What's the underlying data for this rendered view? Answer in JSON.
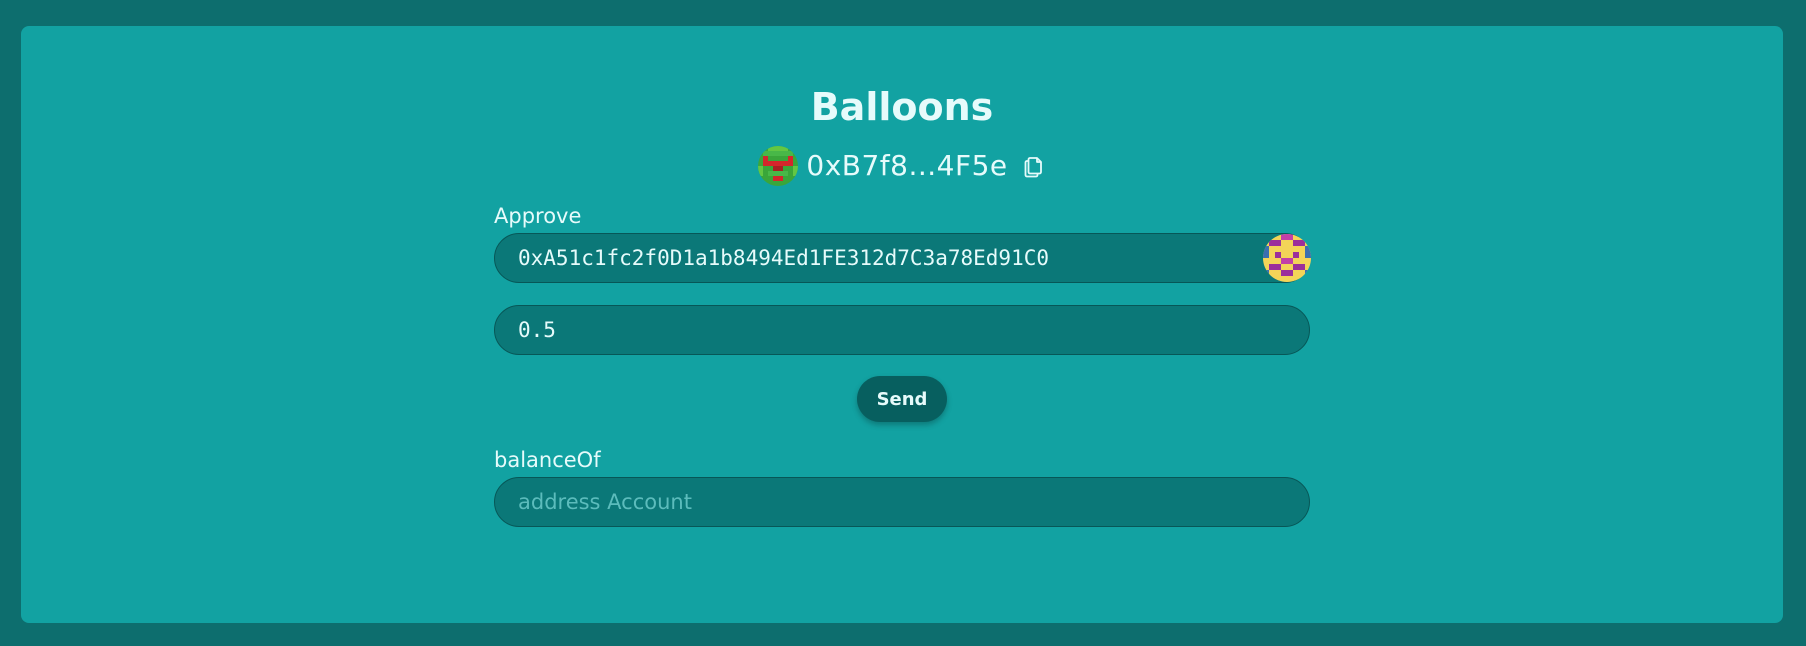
{
  "contract": {
    "name": "Balloons",
    "address_short": "0xB7f8...4F5e",
    "avatar_icon": "green-pixel-avatar-icon"
  },
  "icons": {
    "copy": "copy-icon",
    "spender_avatar": "yellow-purple-pixel-avatar-icon"
  },
  "approve": {
    "label": "Approve",
    "spender_value": "0xA51c1fc2f0D1a1b8494Ed1FE312d7C3a78Ed91C0",
    "amount_value": "0.5",
    "send_label": "Send"
  },
  "balanceOf": {
    "label": "balanceOf",
    "placeholder": "address Account"
  },
  "colors": {
    "page_bg": "#0d6e6e",
    "card_bg": "#12a2a2",
    "input_bg": "#0b7878",
    "button_bg": "#075f5f",
    "text": "#e6fbfb"
  }
}
